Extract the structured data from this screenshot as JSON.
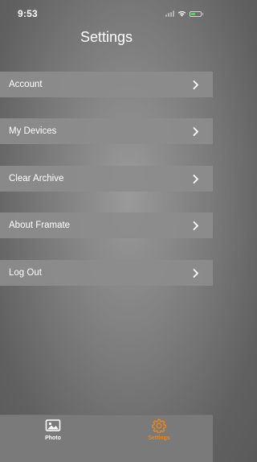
{
  "status_bar": {
    "time": "9:53"
  },
  "header": {
    "title": "Settings"
  },
  "menu": [
    {
      "label": "Account"
    },
    {
      "label": "My Devices"
    },
    {
      "label": "Clear Archive"
    },
    {
      "label": "About Framate"
    },
    {
      "label": "Log Out"
    }
  ],
  "tab_bar": {
    "tabs": [
      {
        "label": "Photo",
        "icon": "photo-icon",
        "active": false
      },
      {
        "label": "Settings",
        "icon": "gear-icon",
        "active": true
      }
    ]
  },
  "colors": {
    "accent": "#e8861c",
    "row_background": "#8c8c8c",
    "tab_bar_background": "#7a7a7a"
  }
}
